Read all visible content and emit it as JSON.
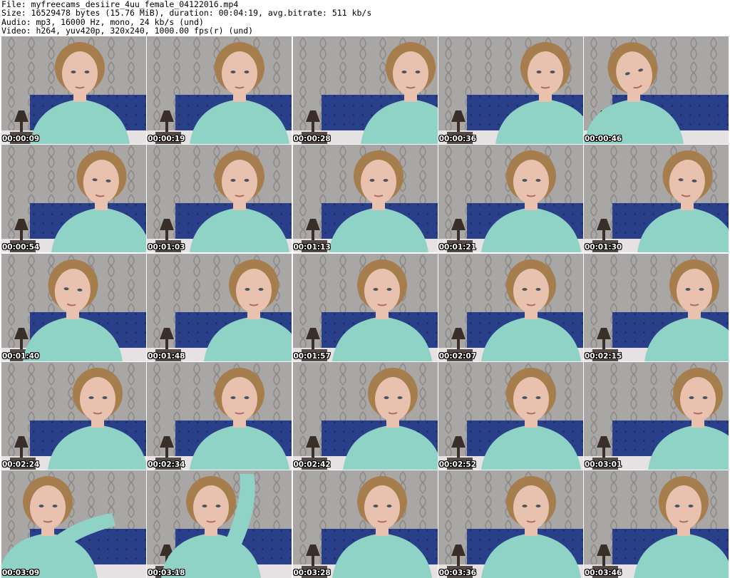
{
  "header": {
    "lines": [
      "File: myfreecams_desiire_4uu_female_04122016.mp4",
      "Size: 16529478 bytes (15.76 MiB), duration: 00:04:19, avg.bitrate: 511 kb/s",
      "Audio: mp3, 16000 Hz, mono, 24 kb/s (und)",
      "Video: h264, yuv420p, 320x240, 1000.00 fps(r) (und)"
    ]
  },
  "colors": {
    "wallpaper": "#a9a7a6",
    "wallpaper_pattern": "#8f8b8a",
    "headboard": "#2a3f8a",
    "headboard_button": "#1b2a60",
    "sweater": "#8fd3c6",
    "skin": "#e8c2ae",
    "hair": "#a67e4e",
    "lamp": "#3a2e28",
    "pillow": "#e6e2e4"
  },
  "thumbnails": [
    {
      "time": "00:00:09"
    },
    {
      "time": "00:00:19"
    },
    {
      "time": "00:00:28"
    },
    {
      "time": "00:00:36"
    },
    {
      "time": "00:00:46"
    },
    {
      "time": "00:00:54"
    },
    {
      "time": "00:01:03"
    },
    {
      "time": "00:01:13"
    },
    {
      "time": "00:01:21"
    },
    {
      "time": "00:01:30"
    },
    {
      "time": "00:01:40"
    },
    {
      "time": "00:01:48"
    },
    {
      "time": "00:01:57"
    },
    {
      "time": "00:02:07"
    },
    {
      "time": "00:02:15"
    },
    {
      "time": "00:02:24"
    },
    {
      "time": "00:02:34"
    },
    {
      "time": "00:02:42"
    },
    {
      "time": "00:02:52"
    },
    {
      "time": "00:03:01"
    },
    {
      "time": "00:03:09"
    },
    {
      "time": "00:03:18"
    },
    {
      "time": "00:03:28"
    },
    {
      "time": "00:03:36"
    },
    {
      "time": "00:03:46"
    }
  ]
}
